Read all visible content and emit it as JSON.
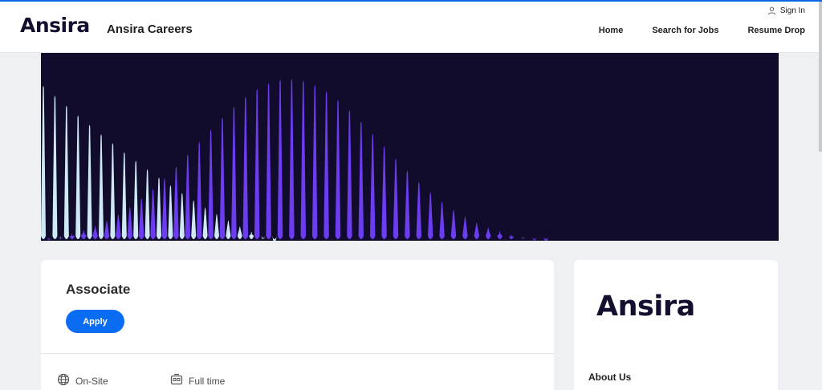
{
  "header": {
    "logo": "Ansira",
    "site_title": "Ansira Careers",
    "signin_label": "Sign In",
    "nav": [
      "Home",
      "Search for Jobs",
      "Resume Drop"
    ]
  },
  "job": {
    "title": "Associate",
    "apply_label": "Apply",
    "workplace": "On-Site",
    "employment_type": "Full time"
  },
  "sidebar": {
    "logo": "Ansira",
    "about_heading": "About Us"
  },
  "colors": {
    "accent": "#0a6cf2",
    "banner_bg": "#120c2c",
    "wave_purple": "#6b3cf0",
    "wave_light": "#cfe8f5"
  }
}
